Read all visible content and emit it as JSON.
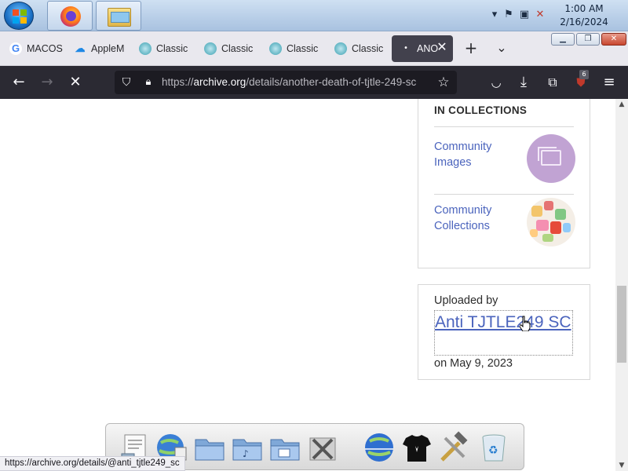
{
  "taskbar": {
    "clock_time": "1:00 AM",
    "clock_date": "2/16/2024",
    "pinned": [
      {
        "name": "firefox"
      },
      {
        "name": "windows-explorer"
      }
    ]
  },
  "browser": {
    "tabs": [
      {
        "label": "MACOS",
        "favicon": "google-icon"
      },
      {
        "label": "AppleM",
        "favicon": "cloud-icon"
      },
      {
        "label": "Classic",
        "favicon": "globe-icon"
      },
      {
        "label": "Classic",
        "favicon": "globe-icon"
      },
      {
        "label": "Classic",
        "favicon": "globe-icon"
      },
      {
        "label": "Classic",
        "favicon": "globe-icon"
      },
      {
        "label": "ANO",
        "active": true,
        "loading": true
      }
    ],
    "url_prefix": "https://",
    "url_host": "archive.org",
    "url_path": "/details/another-death-of-tjtle-249-sc",
    "extension_badge": "6",
    "status_url": "https://archive.org/details/@anti_tjtle249_sc"
  },
  "collections": {
    "heading": "IN COLLECTIONS",
    "items": [
      {
        "label": "Community Images"
      },
      {
        "label": "Community Collections"
      }
    ]
  },
  "uploader": {
    "label": "Uploaded by",
    "name": "Anti TJTLE249 SC",
    "date": "on May 9, 2023"
  },
  "colors": {
    "link": "#4b64bd",
    "toolbar": "#2b2a33",
    "tabstrip": "#e9e8ee"
  }
}
